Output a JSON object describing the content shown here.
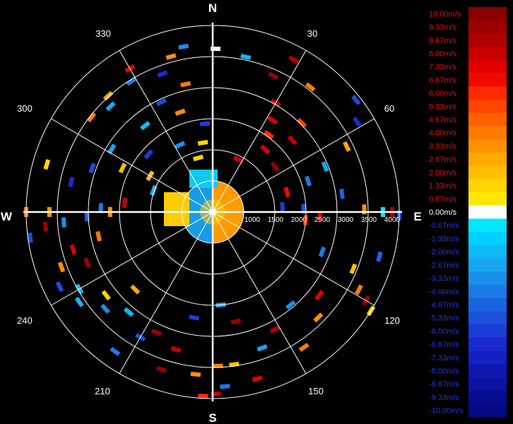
{
  "chart_data": {
    "type": "polar_radial_velocity",
    "cardinals": [
      "N",
      "E",
      "S",
      "W"
    ],
    "bearing_labels": [
      "30",
      "60",
      "120",
      "150",
      "210",
      "240",
      "300",
      "330"
    ],
    "range_ticks": [
      "1000",
      "1500",
      "2000",
      "2500",
      "3000",
      "3500",
      "4000"
    ],
    "range_max": 4000,
    "rings": 6,
    "spokes_deg": [
      0,
      30,
      60,
      90,
      120,
      150,
      180,
      210,
      240,
      270,
      300,
      330
    ],
    "colorbar": [
      {
        "label": "10.00m/s",
        "value": 10.0,
        "color": "#8a0000"
      },
      {
        "label": "9.33m/s",
        "value": 9.33,
        "color": "#9c0000"
      },
      {
        "label": "8.67m/s",
        "value": 8.67,
        "color": "#b00000"
      },
      {
        "label": "8.00m/s",
        "value": 8.0,
        "color": "#c80000"
      },
      {
        "label": "7.33m/s",
        "value": 7.33,
        "color": "#e00000"
      },
      {
        "label": "6.67m/s",
        "value": 6.67,
        "color": "#f00a00"
      },
      {
        "label": "6.00m/s",
        "value": 6.0,
        "color": "#ff2a00"
      },
      {
        "label": "5.33m/s",
        "value": 5.33,
        "color": "#ff4500"
      },
      {
        "label": "4.67m/s",
        "value": 4.67,
        "color": "#ff6000"
      },
      {
        "label": "4.00m/s",
        "value": 4.0,
        "color": "#ff7a00"
      },
      {
        "label": "3.33m/s",
        "value": 3.33,
        "color": "#ff9000"
      },
      {
        "label": "2.67m/s",
        "value": 2.67,
        "color": "#ffa800"
      },
      {
        "label": "2.00m/s",
        "value": 2.0,
        "color": "#ffbf00"
      },
      {
        "label": "1.33m/s",
        "value": 1.33,
        "color": "#ffd500"
      },
      {
        "label": "0.67m/s",
        "value": 0.67,
        "color": "#ffe800"
      },
      {
        "label": "0.00m/s",
        "value": 0.0,
        "color": "#ffffff"
      },
      {
        "label": "-0.67m/s",
        "value": -0.67,
        "color": "#00e8ff"
      },
      {
        "label": "-1.33m/s",
        "value": -1.33,
        "color": "#00d0ff"
      },
      {
        "label": "-2.00m/s",
        "value": -2.0,
        "color": "#10baf8"
      },
      {
        "label": "-2.67m/s",
        "value": -2.67,
        "color": "#18a6f0"
      },
      {
        "label": "-3.33m/s",
        "value": -3.33,
        "color": "#1890ea"
      },
      {
        "label": "-4.00m/s",
        "value": -4.0,
        "color": "#1a7ae6"
      },
      {
        "label": "-4.67m/s",
        "value": -4.67,
        "color": "#1a64e0"
      },
      {
        "label": "-5.33m/s",
        "value": -5.33,
        "color": "#1a50dc"
      },
      {
        "label": "-6.00m/s",
        "value": -6.0,
        "color": "#1a3cd8"
      },
      {
        "label": "-6.67m/s",
        "value": -6.67,
        "color": "#1a2ad0"
      },
      {
        "label": "-7.33m/s",
        "value": -7.33,
        "color": "#1420c4"
      },
      {
        "label": "-8.00m/s",
        "value": -8.0,
        "color": "#1018b4"
      },
      {
        "label": "-8.67m/s",
        "value": -8.67,
        "color": "#0c12a4"
      },
      {
        "label": "-9.33m/s",
        "value": -9.33,
        "color": "#080c94"
      },
      {
        "label": "-10.00m/s",
        "value": -10.0,
        "color": "#060884"
      }
    ],
    "legend_label_colors": {
      "positive": "#e01010",
      "zero": "#ffffff",
      "negative": "#1a3cd8"
    },
    "echo_cells": [
      {
        "az": 350,
        "r": 3600,
        "v": -3.3
      },
      {
        "az": 345,
        "r": 3450,
        "v": 3.3
      },
      {
        "az": 330,
        "r": 3550,
        "v": 7.3
      },
      {
        "az": 328,
        "r": 3300,
        "v": -4.0
      },
      {
        "az": 318,
        "r": 3350,
        "v": 2.7
      },
      {
        "az": 316,
        "r": 3150,
        "v": -2.7
      },
      {
        "az": 340,
        "r": 3150,
        "v": -6.7
      },
      {
        "az": 348,
        "r": 2800,
        "v": 4.0
      },
      {
        "az": 335,
        "r": 2600,
        "v": -5.3
      },
      {
        "az": 322,
        "r": 2350,
        "v": -2.0
      },
      {
        "az": 342,
        "r": 2250,
        "v": 3.3
      },
      {
        "az": 355,
        "r": 1900,
        "v": -6.0
      },
      {
        "az": 352,
        "r": 1500,
        "v": 1.3
      },
      {
        "az": 1,
        "r": 3500,
        "v": 0.0
      },
      {
        "az": 12,
        "r": 3400,
        "v": -2.0
      },
      {
        "az": 28,
        "r": 3700,
        "v": 8.7
      },
      {
        "az": 24,
        "r": 3200,
        "v": 9.3
      },
      {
        "az": 30,
        "r": 2700,
        "v": 8.0
      },
      {
        "az": 33,
        "r": 2350,
        "v": 7.3
      },
      {
        "az": 36,
        "r": 2050,
        "v": 6.0
      },
      {
        "az": 40,
        "r": 1750,
        "v": 7.3
      },
      {
        "az": 26,
        "r": 1250,
        "v": 8.0
      },
      {
        "az": 38,
        "r": 3400,
        "v": 4.0
      },
      {
        "az": 45,
        "r": 2700,
        "v": 5.3
      },
      {
        "az": 48,
        "r": 2300,
        "v": 8.0
      },
      {
        "az": 54,
        "r": 1650,
        "v": 9.3
      },
      {
        "az": 58,
        "r": 3650,
        "v": -6.7
      },
      {
        "az": 52,
        "r": 3900,
        "v": -5.3
      },
      {
        "az": 64,
        "r": 3200,
        "v": 2.7
      },
      {
        "az": 68,
        "r": 2600,
        "v": -2.7
      },
      {
        "az": 72,
        "r": 2150,
        "v": -4.0
      },
      {
        "az": 75,
        "r": 1650,
        "v": 6.7
      },
      {
        "az": 82,
        "r": 2800,
        "v": -4.7
      },
      {
        "az": 86,
        "r": 1500,
        "v": -6.0
      },
      {
        "az": 89,
        "r": 3250,
        "v": 3.3
      },
      {
        "az": 90,
        "r": 3650,
        "v": -0.7
      },
      {
        "az": 90,
        "r": 3850,
        "v": 8.7
      },
      {
        "az": 91,
        "r": 4000,
        "v": -5.3
      },
      {
        "az": 88,
        "r": 1950,
        "v": -5.3
      },
      {
        "az": 92,
        "r": 2300,
        "v": 7.3
      },
      {
        "az": 95,
        "r": 2000,
        "v": 6.0
      },
      {
        "az": 105,
        "r": 3700,
        "v": -4.7
      },
      {
        "az": 112,
        "r": 3250,
        "v": 2.0
      },
      {
        "az": 118,
        "r": 3550,
        "v": 4.0
      },
      {
        "az": 120,
        "r": 3800,
        "v": 9.3
      },
      {
        "az": 122,
        "r": 4000,
        "v": 1.3
      },
      {
        "az": 110,
        "r": 2500,
        "v": -4.0
      },
      {
        "az": 128,
        "r": 2900,
        "v": 7.3
      },
      {
        "az": 135,
        "r": 3200,
        "v": 3.3
      },
      {
        "az": 140,
        "r": 2600,
        "v": -3.3
      },
      {
        "az": 146,
        "r": 3500,
        "v": 4.0
      },
      {
        "az": 152,
        "r": 2850,
        "v": 8.7
      },
      {
        "az": 160,
        "r": 3100,
        "v": -2.7
      },
      {
        "az": 165,
        "r": 3700,
        "v": 7.3
      },
      {
        "az": 168,
        "r": 2400,
        "v": 9.3
      },
      {
        "az": 172,
        "r": 3300,
        "v": 2.0
      },
      {
        "az": 175,
        "r": 2000,
        "v": -2.7
      },
      {
        "az": 176,
        "r": 3750,
        "v": -4.0
      },
      {
        "az": 178,
        "r": 3300,
        "v": 4.0
      },
      {
        "az": 179,
        "r": 3900,
        "v": 8.0
      },
      {
        "az": 183,
        "r": 3950,
        "v": 6.0
      },
      {
        "az": 186,
        "r": 3500,
        "v": 3.3
      },
      {
        "az": 190,
        "r": 2300,
        "v": -6.0
      },
      {
        "az": 195,
        "r": 3050,
        "v": 8.0
      },
      {
        "az": 198,
        "r": 3550,
        "v": 9.3
      },
      {
        "az": 205,
        "r": 2850,
        "v": 9.3
      },
      {
        "az": 210,
        "r": 3100,
        "v": -5.3
      },
      {
        "az": 215,
        "r": 3650,
        "v": -4.0
      },
      {
        "az": 220,
        "r": 2800,
        "v": -2.0
      },
      {
        "az": 225,
        "r": 2350,
        "v": 2.7
      },
      {
        "az": 228,
        "r": 3100,
        "v": -3.3
      },
      {
        "az": 232,
        "r": 2900,
        "v": 1.3
      },
      {
        "az": 236,
        "r": 3450,
        "v": -2.0
      },
      {
        "az": 240,
        "r": 3300,
        "v": -2.0
      },
      {
        "az": 244,
        "r": 3650,
        "v": -5.3
      },
      {
        "az": 248,
        "r": 2900,
        "v": 9.3
      },
      {
        "az": 250,
        "r": 3450,
        "v": 3.3
      },
      {
        "az": 255,
        "r": 3100,
        "v": 7.3
      },
      {
        "az": 258,
        "r": 2500,
        "v": 4.0
      },
      {
        "az": 262,
        "r": 3950,
        "v": -5.3
      },
      {
        "az": 265,
        "r": 3600,
        "v": 9.3
      },
      {
        "az": 266,
        "r": 3200,
        "v": -3.3
      },
      {
        "az": 268,
        "r": 2700,
        "v": -4.7
      },
      {
        "az": 270,
        "r": 4000,
        "v": 4.0
      },
      {
        "az": 270,
        "r": 3500,
        "v": 3.3
      },
      {
        "az": 270,
        "r": 2200,
        "v": 3.3
      },
      {
        "az": 272,
        "r": 2400,
        "v": -4.0
      },
      {
        "az": 276,
        "r": 1900,
        "v": 8.0
      },
      {
        "az": 282,
        "r": 3100,
        "v": -6.7
      },
      {
        "az": 286,
        "r": 3700,
        "v": 1.3
      },
      {
        "az": 290,
        "r": 2750,
        "v": -5.3
      },
      {
        "az": 296,
        "r": 2150,
        "v": 2.0
      },
      {
        "az": 302,
        "r": 2550,
        "v": -2.7
      },
      {
        "az": 308,
        "r": 3300,
        "v": 4.0
      },
      {
        "az": 312,
        "r": 1850,
        "v": -6.0
      },
      {
        "az": 290,
        "r": 1350,
        "v": -2.0
      },
      {
        "az": 300,
        "r": 1550,
        "v": 2.0
      },
      {
        "az": 334,
        "r": 1600,
        "v": -3.3
      },
      {
        "az": 345,
        "r": 1200,
        "v": 1.3
      }
    ]
  }
}
